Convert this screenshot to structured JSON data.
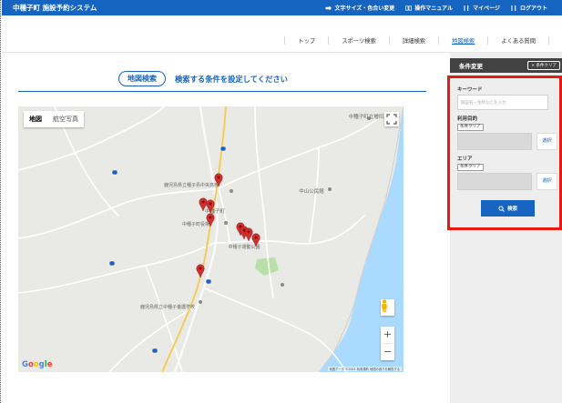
{
  "header": {
    "brand": "中種子町 施設予約システム",
    "menu": [
      {
        "label": "文字サイズ・色合い変更",
        "icon": "palette-icon"
      },
      {
        "label": "操作マニュアル",
        "icon": "book-icon"
      },
      {
        "label": "マイページ",
        "icon": "menu-icon"
      },
      {
        "label": "ログアウト",
        "icon": "logout-icon"
      }
    ]
  },
  "nav": {
    "items": [
      "トップ",
      "スポーツ検索",
      "詳細検索",
      "地図検索",
      "よくある質問"
    ],
    "active_index": 3
  },
  "main": {
    "badge": "地図検索",
    "instruction": "検索する条件を設定してください"
  },
  "map": {
    "tabs": [
      "地図",
      "航空写真"
    ],
    "brand": "Google",
    "attribution": "地図データ ©2021 利用規約 地図の誤りを報告する",
    "labels": [
      "中種子町立増田",
      "中山公民館",
      "鹿児島県立種子島中央高校",
      "中種子町",
      "中種子町役場",
      "中種子運動公園",
      "鹿児島県立中種子養護学校"
    ]
  },
  "sidebar": {
    "title": "条件変更",
    "clear_all": "× 条件クリア",
    "keyword_label": "キーワード",
    "keyword_placeholder": "施設名・住所などを入力",
    "purpose_label": "利用目的",
    "purpose_clear": "条件クリア",
    "purpose_select": "選択",
    "area_label": "エリア",
    "area_clear": "条件クリア",
    "area_select": "選択",
    "search_label": "検索"
  },
  "colors": {
    "primary": "#1565c0",
    "highlight": "#e8190f",
    "sidebar_header": "#424242",
    "pin": "#d32f2f"
  }
}
